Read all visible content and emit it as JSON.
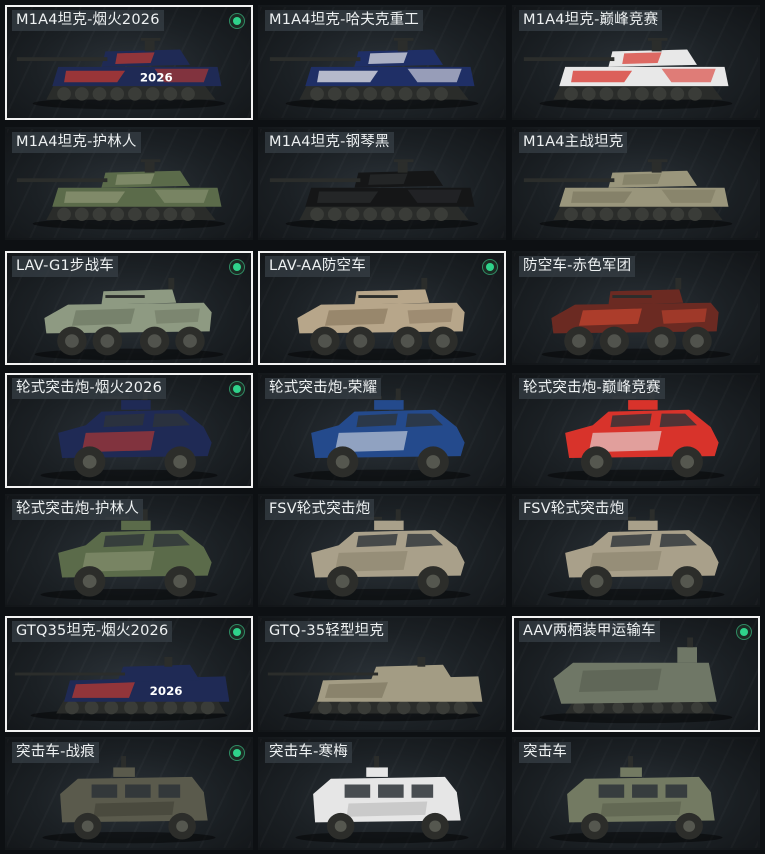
{
  "cards": [
    {
      "label": "M1A4坦克-烟火2026",
      "selected": true,
      "badge": true,
      "vehicle": "tank",
      "camo": "fireworks",
      "camo_colors": [
        "#1f2a55",
        "#c33a2f"
      ],
      "decal": "2026"
    },
    {
      "label": "M1A4坦克-哈夫克重工",
      "selected": false,
      "badge": false,
      "vehicle": "tank",
      "camo": "haavk",
      "camo_colors": [
        "#1f2f66",
        "#e8e8ee"
      ],
      "decal": ""
    },
    {
      "label": "M1A4坦克-巅峰竞赛",
      "selected": false,
      "badge": false,
      "vehicle": "tank",
      "camo": "racing",
      "camo_colors": [
        "#e8e8e8",
        "#d8332b"
      ],
      "decal": ""
    },
    {
      "label": "M1A4坦克-护林人",
      "selected": false,
      "badge": false,
      "vehicle": "tank",
      "camo": "woodland",
      "camo_colors": [
        "#5b6b4a",
        "#8c9474"
      ],
      "decal": ""
    },
    {
      "label": "M1A4坦克-钢琴黑",
      "selected": false,
      "badge": false,
      "vehicle": "tank",
      "camo": "piano-black",
      "camo_colors": [
        "#151617",
        "#2a2c2e"
      ],
      "decal": ""
    },
    {
      "label": "M1A4主战坦克",
      "selected": false,
      "badge": false,
      "vehicle": "tank",
      "camo": "default",
      "camo_colors": [
        "#9a967c",
        "#7e7a63"
      ],
      "decal": ""
    },
    {
      "label": "LAV-G1步战车",
      "selected": true,
      "badge": true,
      "vehicle": "apc",
      "camo": "default",
      "camo_colors": [
        "#8e9a82",
        "#6f7a64"
      ],
      "decal": ""
    },
    {
      "label": "LAV-AA防空车",
      "selected": true,
      "badge": true,
      "vehicle": "apc",
      "camo": "desert",
      "camo_colors": [
        "#b7a68a",
        "#8d7c62"
      ],
      "decal": ""
    },
    {
      "label": "防空车-赤色军团",
      "selected": false,
      "badge": false,
      "vehicle": "apc",
      "camo": "red-legion",
      "camo_colors": [
        "#6b2a22",
        "#c2442f"
      ],
      "decal": ""
    },
    {
      "label": "轮式突击炮-烟火2026",
      "selected": true,
      "badge": true,
      "vehicle": "mrap",
      "camo": "fireworks",
      "camo_colors": [
        "#1f2a55",
        "#c33a2f"
      ],
      "decal": ""
    },
    {
      "label": "轮式突击炮-荣耀",
      "selected": false,
      "badge": false,
      "vehicle": "mrap",
      "camo": "glory",
      "camo_colors": [
        "#244a8c",
        "#d8dde4"
      ],
      "decal": ""
    },
    {
      "label": "轮式突击炮-巅峰竞赛",
      "selected": false,
      "badge": false,
      "vehicle": "mrap",
      "camo": "racing",
      "camo_colors": [
        "#d8332b",
        "#e8e8e8"
      ],
      "decal": ""
    },
    {
      "label": "轮式突击炮-护林人",
      "selected": false,
      "badge": false,
      "vehicle": "mrap",
      "camo": "woodland",
      "camo_colors": [
        "#5b6b4a",
        "#8c9474"
      ],
      "decal": ""
    },
    {
      "label": "FSV轮式突击炮",
      "selected": false,
      "badge": false,
      "vehicle": "mrap",
      "camo": "default",
      "camo_colors": [
        "#a9a08a",
        "#8a826d"
      ],
      "decal": ""
    },
    {
      "label": "FSV轮式突击炮",
      "selected": false,
      "badge": false,
      "vehicle": "mrap",
      "camo": "default",
      "camo_colors": [
        "#a9a08a",
        "#8a826d"
      ],
      "decal": ""
    },
    {
      "label": "GTQ35坦克-烟火2026",
      "selected": true,
      "badge": true,
      "vehicle": "light-tank",
      "camo": "fireworks",
      "camo_colors": [
        "#1f2a55",
        "#c33a2f"
      ],
      "decal": "2026"
    },
    {
      "label": "GTQ-35轻型坦克",
      "selected": false,
      "badge": false,
      "vehicle": "light-tank",
      "camo": "default",
      "camo_colors": [
        "#a39c84",
        "#7f7963"
      ],
      "decal": ""
    },
    {
      "label": "AAV两栖装甲运输车",
      "selected": true,
      "badge": true,
      "vehicle": "amphibious",
      "camo": "default",
      "camo_colors": [
        "#6f7766",
        "#565d4f"
      ],
      "decal": ""
    },
    {
      "label": "突击车-战痕",
      "selected": false,
      "badge": true,
      "vehicle": "assault-car",
      "camo": "battle-scar",
      "camo_colors": [
        "#5a5a4c",
        "#3f3f35"
      ],
      "decal": ""
    },
    {
      "label": "突击车-寒梅",
      "selected": false,
      "badge": false,
      "vehicle": "assault-car",
      "camo": "plum",
      "camo_colors": [
        "#e6e6e6",
        "#b8b8b8"
      ],
      "decal": ""
    },
    {
      "label": "突击车",
      "selected": false,
      "badge": false,
      "vehicle": "assault-car",
      "camo": "default",
      "camo_colors": [
        "#737a62",
        "#585e4b"
      ],
      "decal": ""
    }
  ]
}
